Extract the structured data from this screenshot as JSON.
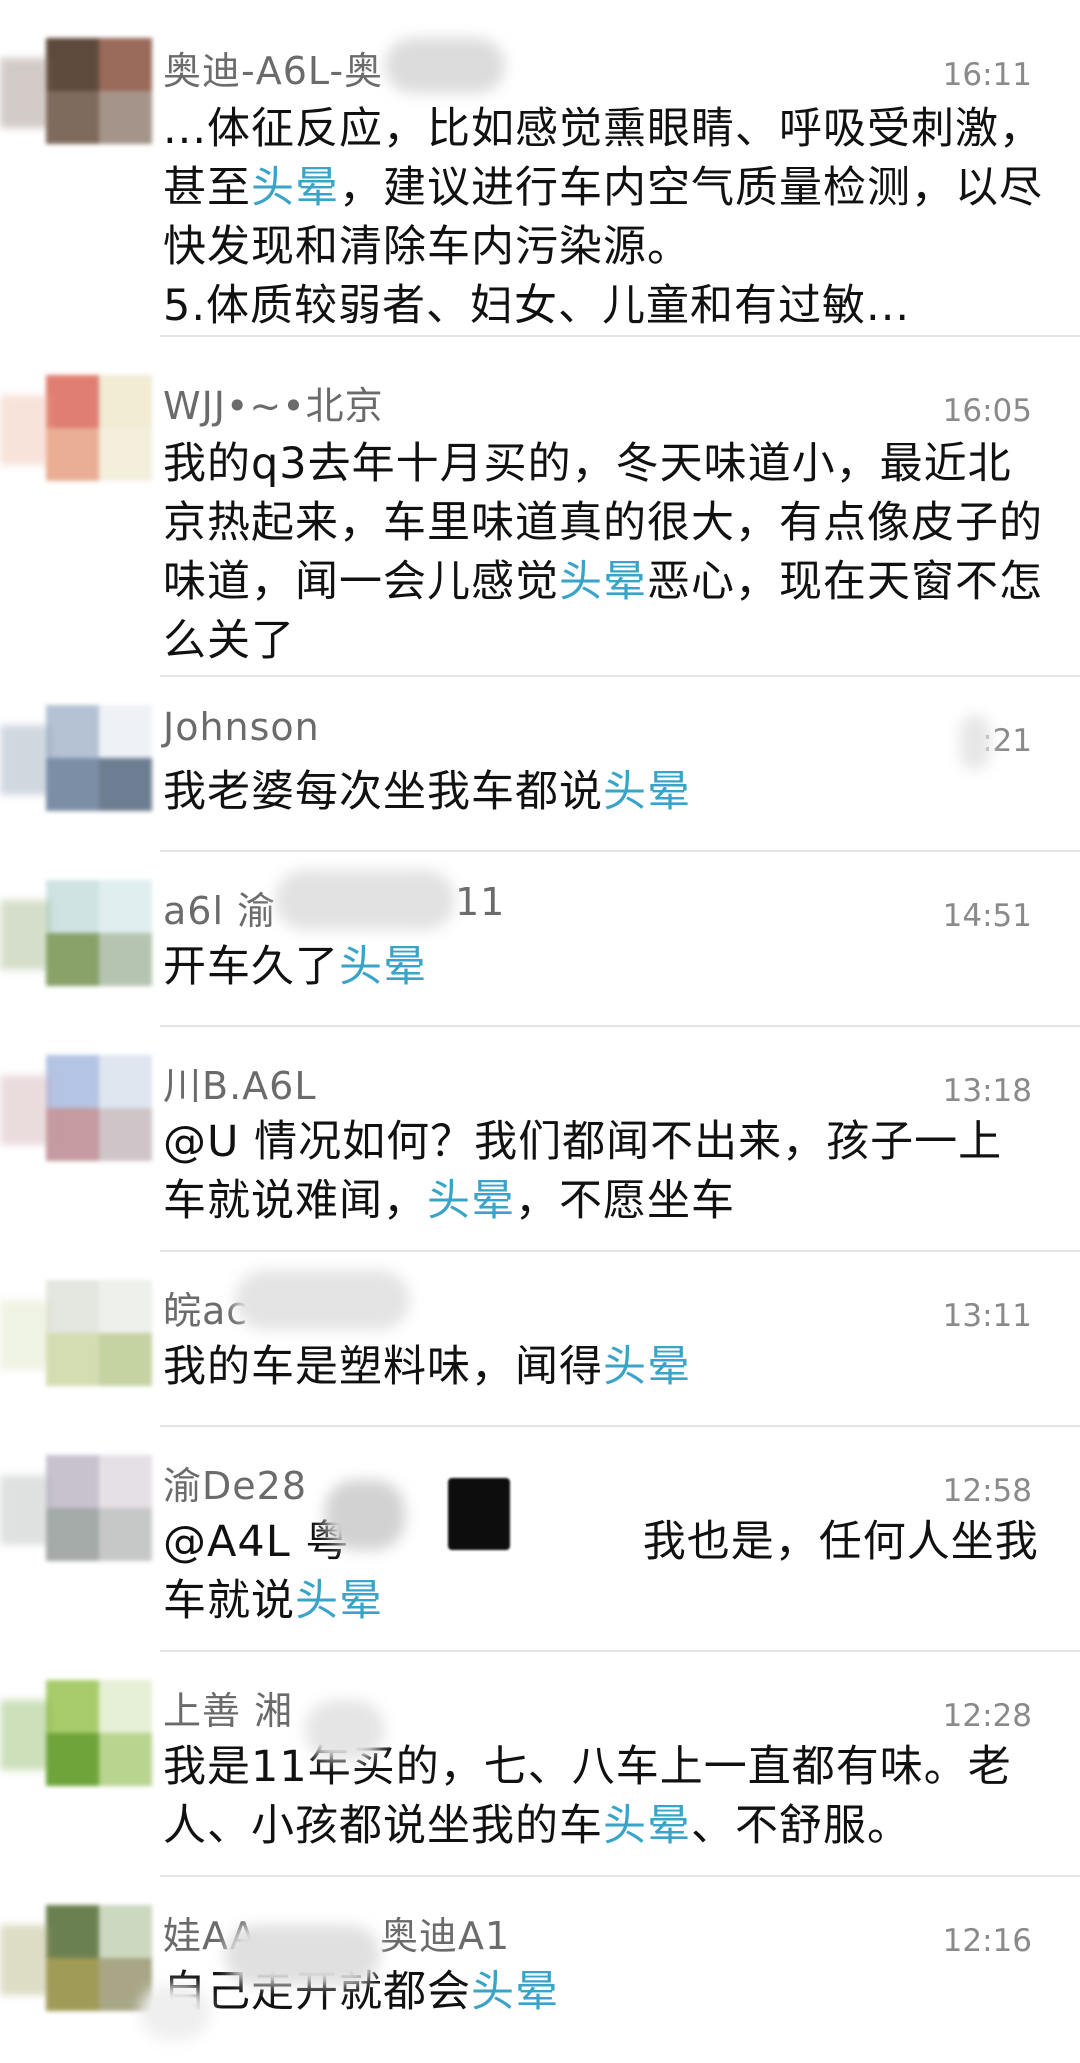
{
  "colors": {
    "highlight": "#3aa3c8",
    "name": "#6b6b6b",
    "time": "#8a8a8a",
    "text": "#111111",
    "divider": "#e4e4e4"
  },
  "messages": [
    {
      "name": "奥迪-A6L-奥",
      "time": "16:11",
      "avatar_icon": "pixelated-avatar-icon",
      "avatar_colors": [
        "#5e4a3c",
        "#9a6a5a",
        "#7f6a5e",
        "#a4948a"
      ],
      "segments": [
        {
          "t": "...体征反应，比如感觉熏眼睛、呼吸受刺激，甚至"
        },
        {
          "t": "头晕",
          "hl": true
        },
        {
          "t": "，建议进行车内空气质量检测，以尽快发现和清除车内污染源。\n5.体质较弱者、妇女、儿童和有过敏..."
        }
      ]
    },
    {
      "name": "WJJ•~•北京",
      "time": "16:05",
      "avatar_icon": "pixelated-avatar-icon",
      "avatar_colors": [
        "#e07e72",
        "#f1ecd3",
        "#eaae95",
        "#f4eedd"
      ],
      "segments": [
        {
          "t": "我的q3去年十月买的，冬天味道小，最近北京热起来，车里味道真的很大，有点像皮子的味道，闻一会儿感觉"
        },
        {
          "t": "头晕",
          "hl": true
        },
        {
          "t": "恶心，现在天窗不怎么关了"
        }
      ]
    },
    {
      "name": "Johnson",
      "time": ":21",
      "avatar_icon": "pixelated-avatar-icon",
      "avatar_colors": [
        "#b4c2d4",
        "#eef1f6",
        "#7c8ea6",
        "#6e7e92"
      ],
      "segments": [
        {
          "t": "我老婆每次坐我车都说"
        },
        {
          "t": "头晕",
          "hl": true
        }
      ]
    },
    {
      "name": "a6l 渝",
      "name_tail": "11",
      "time": "14:51",
      "avatar_icon": "pixelated-avatar-icon",
      "avatar_colors": [
        "#cfe3e3",
        "#e0eef0",
        "#88a26a",
        "#b5c4b0"
      ],
      "segments": [
        {
          "t": "开车久了"
        },
        {
          "t": "头晕",
          "hl": true
        }
      ]
    },
    {
      "name": "川B.A6L",
      "time": "13:18",
      "avatar_icon": "pixelated-avatar-icon",
      "avatar_colors": [
        "#b4c4e4",
        "#dfe6f0",
        "#c59aa0",
        "#cfc5c8"
      ],
      "segments": [
        {
          "t": "@U 情况如何？我们都闻不出来，孩子一上车就说难闻，"
        },
        {
          "t": "头晕",
          "hl": true
        },
        {
          "t": "，不愿坐车"
        }
      ]
    },
    {
      "name": "皖ac",
      "time": "13:11",
      "avatar_icon": "pixelated-avatar-icon",
      "avatar_colors": [
        "#e4e6e0",
        "#eef0ec",
        "#d4ddb2",
        "#c5d2a2"
      ],
      "segments": [
        {
          "t": "我的车是塑料味，闻得"
        },
        {
          "t": "头晕",
          "hl": true
        }
      ]
    },
    {
      "name": "渝De28",
      "time": "12:58",
      "avatar_icon": "pixelated-avatar-icon",
      "avatar_colors": [
        "#c8c2cf",
        "#e5e0e6",
        "#a4aaa8",
        "#c6c8c8"
      ],
      "segments": [
        {
          "t": "@A4L 粤                    我也是，任何人坐我车就说"
        },
        {
          "t": "头晕",
          "hl": true
        }
      ]
    },
    {
      "name": "上善 湘",
      "time": "12:28",
      "avatar_icon": "pixelated-avatar-icon",
      "avatar_colors": [
        "#a8cc6c",
        "#e6f0d6",
        "#6ea43a",
        "#b8d48e"
      ],
      "segments": [
        {
          "t": "我是11年买的，七、八车上一直都有味。老人、小孩都说坐我的车"
        },
        {
          "t": "头晕",
          "hl": true
        },
        {
          "t": "、不舒服。"
        }
      ]
    },
    {
      "name": "娃AA",
      "name_tail": "奥迪A1",
      "time": "12:16",
      "avatar_icon": "pixelated-avatar-icon",
      "avatar_colors": [
        "#6b8050",
        "#cdd8c0",
        "#a09c58",
        "#a8a686"
      ],
      "segments": [
        {
          "t": "自己走开就都会"
        },
        {
          "t": "头晕",
          "hl": true
        }
      ]
    }
  ]
}
